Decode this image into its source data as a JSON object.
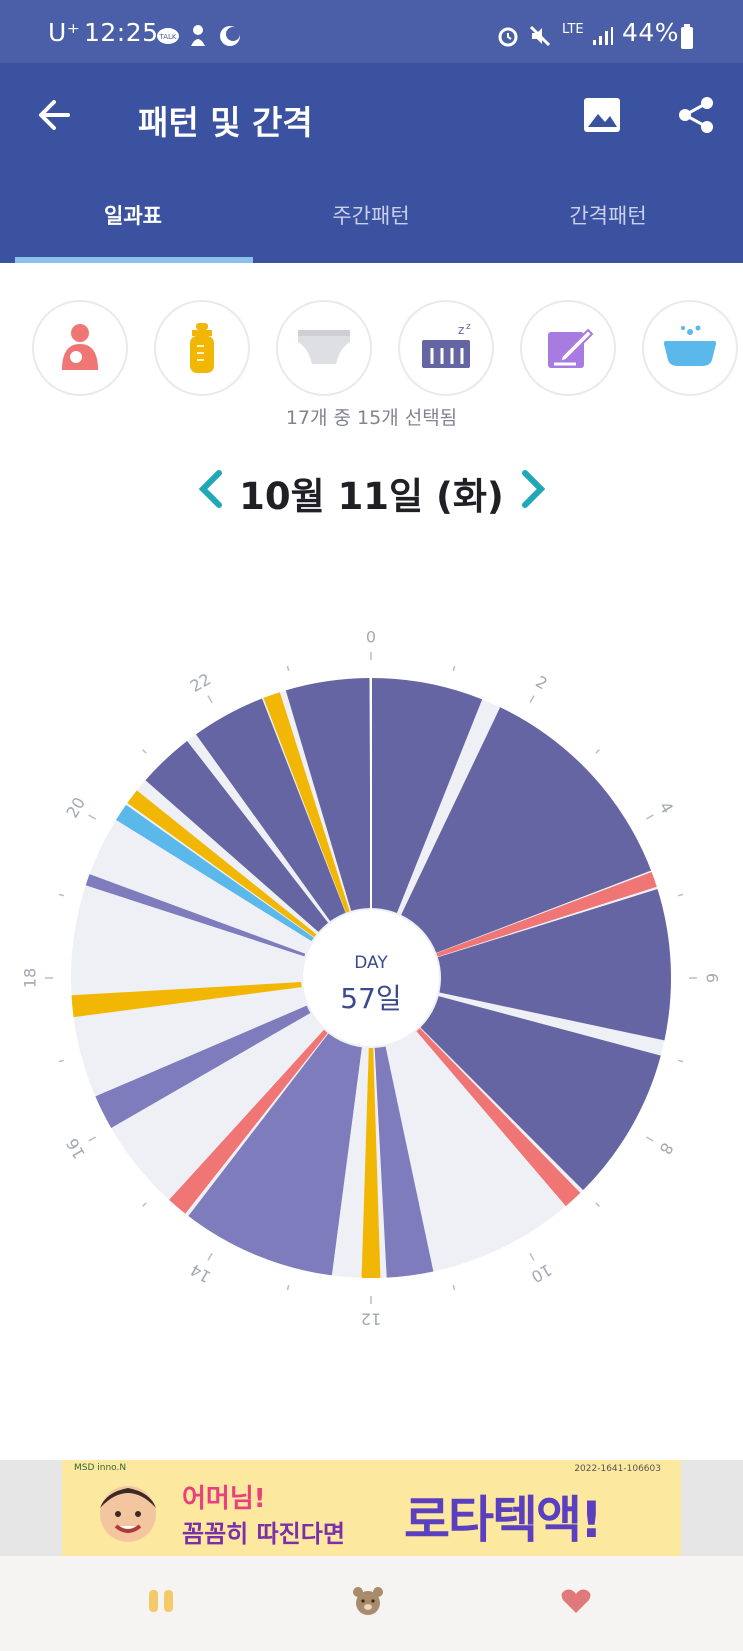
{
  "status_bar": {
    "carrier": "U⁺",
    "time": "12:25",
    "network": "LTE",
    "battery": "44%",
    "icons": [
      "talk-icon",
      "baby-icon",
      "moon-icon",
      "alarm-icon",
      "mute-icon",
      "signal-icon",
      "battery-icon"
    ]
  },
  "header": {
    "title": "패턴 및 간격",
    "back_icon": "arrow-left-icon",
    "image_icon": "image-icon",
    "share_icon": "share-icon",
    "background": "#3b52a0"
  },
  "tabs": [
    {
      "label": "일과표",
      "active": true
    },
    {
      "label": "주간패턴",
      "active": false
    },
    {
      "label": "간격패턴",
      "active": false
    }
  ],
  "categories": [
    {
      "name": "breastfeeding-icon",
      "color": "#f07575"
    },
    {
      "name": "bottle-icon",
      "color": "#f2b705"
    },
    {
      "name": "diaper-icon",
      "color": "#d9d9de"
    },
    {
      "name": "sleep-crib-icon",
      "color": "#6665a4"
    },
    {
      "name": "memo-icon",
      "color": "#a77be0"
    },
    {
      "name": "bath-icon",
      "color": "#5bb8ea"
    }
  ],
  "selection_summary": "17개 중 15개 선택됨",
  "date": {
    "label": "10월 11일 (화)",
    "prev_icon": "chevron-left-icon",
    "next_icon": "chevron-right-icon",
    "arrow_color": "#1fa8b8"
  },
  "center": {
    "label": "DAY",
    "value": "57일"
  },
  "chart_data": {
    "type": "pie",
    "hour_labels": [
      "0",
      "2",
      "4",
      "6",
      "8",
      "10",
      "12",
      "14",
      "16",
      "18",
      "20",
      "22"
    ],
    "legend": {
      "sleep": "#6665a4",
      "sleep_light": "#7e7cbc",
      "feeding_bottle": "#f2b705",
      "breastfeeding": "#f07575",
      "bath": "#5bb8ea",
      "free": "#eef0f5"
    },
    "segments": [
      {
        "start": 0.0,
        "end": 1.45,
        "type": "sleep"
      },
      {
        "start": 1.7,
        "end": 4.6,
        "type": "sleep"
      },
      {
        "start": 4.62,
        "end": 4.82,
        "type": "breastfeeding"
      },
      {
        "start": 4.85,
        "end": 6.8,
        "type": "sleep"
      },
      {
        "start": 7.0,
        "end": 9.0,
        "type": "sleep"
      },
      {
        "start": 9.05,
        "end": 9.3,
        "type": "breastfeeding"
      },
      {
        "start": 11.2,
        "end": 11.8,
        "type": "sleep_light"
      },
      {
        "start": 11.88,
        "end": 12.12,
        "type": "feeding_bottle"
      },
      {
        "start": 12.5,
        "end": 14.5,
        "type": "sleep_light"
      },
      {
        "start": 14.55,
        "end": 14.82,
        "type": "breastfeeding"
      },
      {
        "start": 16.0,
        "end": 16.45,
        "type": "sleep_light"
      },
      {
        "start": 17.5,
        "end": 17.78,
        "type": "feeding_bottle"
      },
      {
        "start": 19.2,
        "end": 19.35,
        "type": "sleep_light"
      },
      {
        "start": 20.12,
        "end": 20.35,
        "type": "bath"
      },
      {
        "start": 20.38,
        "end": 20.58,
        "type": "feeding_bottle"
      },
      {
        "start": 20.75,
        "end": 21.48,
        "type": "sleep"
      },
      {
        "start": 21.62,
        "end": 22.58,
        "type": "sleep"
      },
      {
        "start": 22.6,
        "end": 22.82,
        "type": "feeding_bottle"
      },
      {
        "start": 22.9,
        "end": 23.98,
        "type": "sleep"
      }
    ]
  },
  "ad": {
    "brand": "MSD  inno.N",
    "code": "2022-1641-106603",
    "line1": "어머님!",
    "line2": "꼼꼼히 따진다면",
    "big": "로타텍액!"
  },
  "bottom_nav": [
    {
      "name": "pause-icon",
      "color": "#f3c96a"
    },
    {
      "name": "bear-icon",
      "color": "#a98a6a"
    },
    {
      "name": "heart-icon",
      "color": "#e07a7a"
    }
  ]
}
